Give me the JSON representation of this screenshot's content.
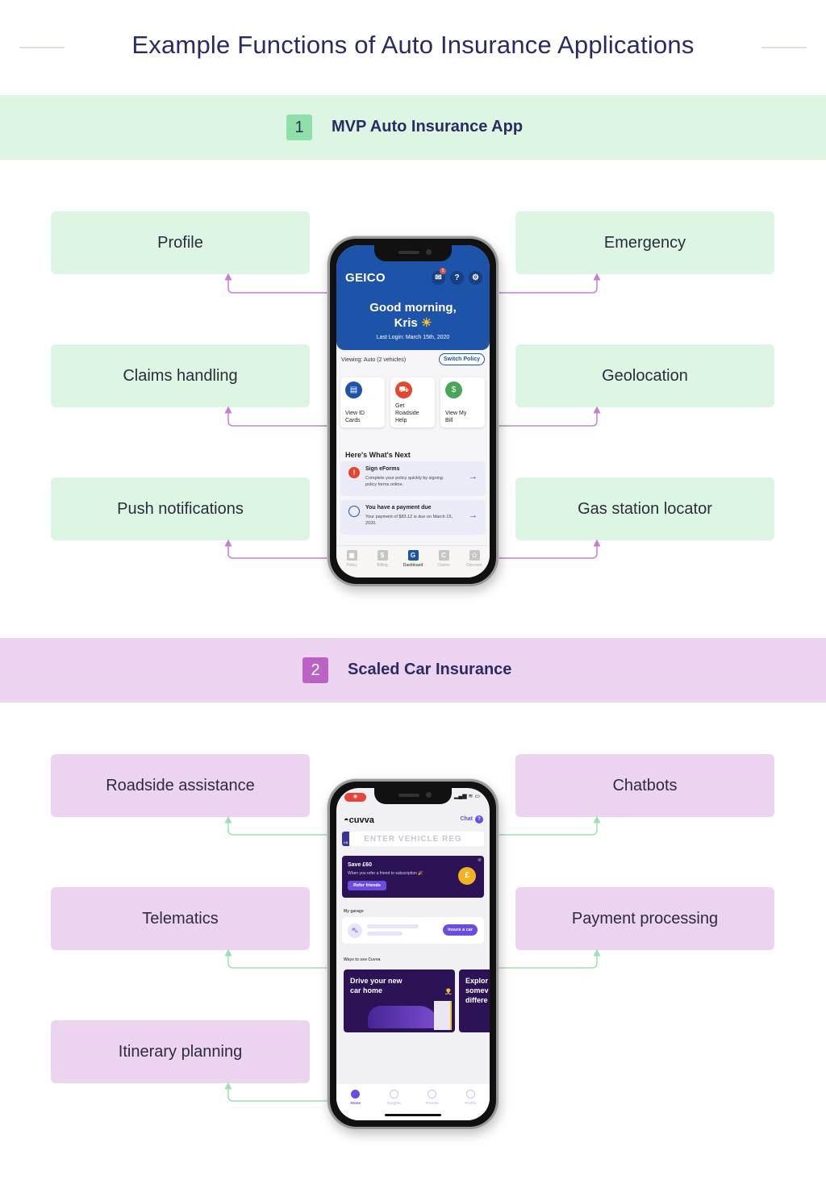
{
  "title": "Example Functions of Auto Insurance Applications",
  "colors": {
    "green_band": "#ddf5e3",
    "purple_band": "#ecd3ef",
    "green_num": "#8fe0a8",
    "purple_num": "#bb63c5",
    "purple_connector": "#c77fd4",
    "green_connector": "#9be2b0",
    "title_text": "#2b2b63"
  },
  "sections": [
    {
      "number": "1",
      "label": "MVP Auto Insurance App",
      "features_left": [
        "Profile",
        "Claims handling",
        "Push notifications"
      ],
      "features_right": [
        "Emergency",
        "Geolocation",
        "Gas station locator"
      ]
    },
    {
      "number": "2",
      "label": "Scaled Car Insurance",
      "features_left": [
        "Roadside assistance",
        "Telematics",
        "Itinerary planning"
      ],
      "features_right": [
        "Chatbots",
        "Payment processing"
      ]
    }
  ],
  "geico": {
    "logo": "GEICO",
    "mail_badge": "1",
    "help_icon": "?",
    "settings_icon": "⚙",
    "greeting_line1": "Good morning,",
    "greeting_line2": "Kris",
    "sun": "☀",
    "last_login": "Last Login: March 15th, 2020",
    "viewing": "Viewing: Auto (2 vehicles)",
    "switch_policy": "Switch Policy",
    "cards": [
      {
        "label_1": "View ID",
        "label_2": "Cards",
        "label_3": "",
        "icon": "▤",
        "color": "#1d53a8"
      },
      {
        "label_1": "Get",
        "label_2": "Roadside",
        "label_3": "Help",
        "icon": "⛟",
        "color": "#e3452f"
      },
      {
        "label_1": "View My",
        "label_2": "Bill",
        "label_3": "",
        "icon": "$",
        "color": "#4aa55a"
      }
    ],
    "next_heading": "Here's What's Next",
    "tasks": [
      {
        "title": "Sign eForms",
        "desc": "Complete your policy quickly by signing policy forms online.",
        "icon": "!",
        "arrow": "→"
      },
      {
        "title": "You have a payment due",
        "desc": "Your payment of $83.12 is due on March 15, 2020.",
        "icon": "",
        "arrow": "→"
      }
    ],
    "nav": [
      {
        "label": "Policy",
        "icon": "▣"
      },
      {
        "label": "Billing",
        "icon": "$"
      },
      {
        "label": "Dashboard",
        "icon": "G"
      },
      {
        "label": "Claims",
        "icon": "C"
      },
      {
        "label": "Discover",
        "icon": "✩"
      }
    ]
  },
  "cuvva": {
    "logo": "cuvva",
    "chat": "Chat",
    "chat_icon": "?",
    "reg_country": "GB",
    "reg_placeholder": "ENTER VEHICLE REG",
    "promo_title": "Save £60",
    "promo_desc": "When you refer a friend to subscription 🎉",
    "promo_button": "Refer friends",
    "promo_coin": "£",
    "garage_label": "My garage",
    "garage_button": "Insure a car",
    "ways_label": "Ways to use Cuvva",
    "tile1_line1": "Drive your new",
    "tile1_line2": "car home",
    "tile2_line1": "Explor",
    "tile2_line2": "somev",
    "tile2_line3": "differe",
    "nav": [
      "Home",
      "Insights",
      "Friends",
      "Profile"
    ]
  }
}
